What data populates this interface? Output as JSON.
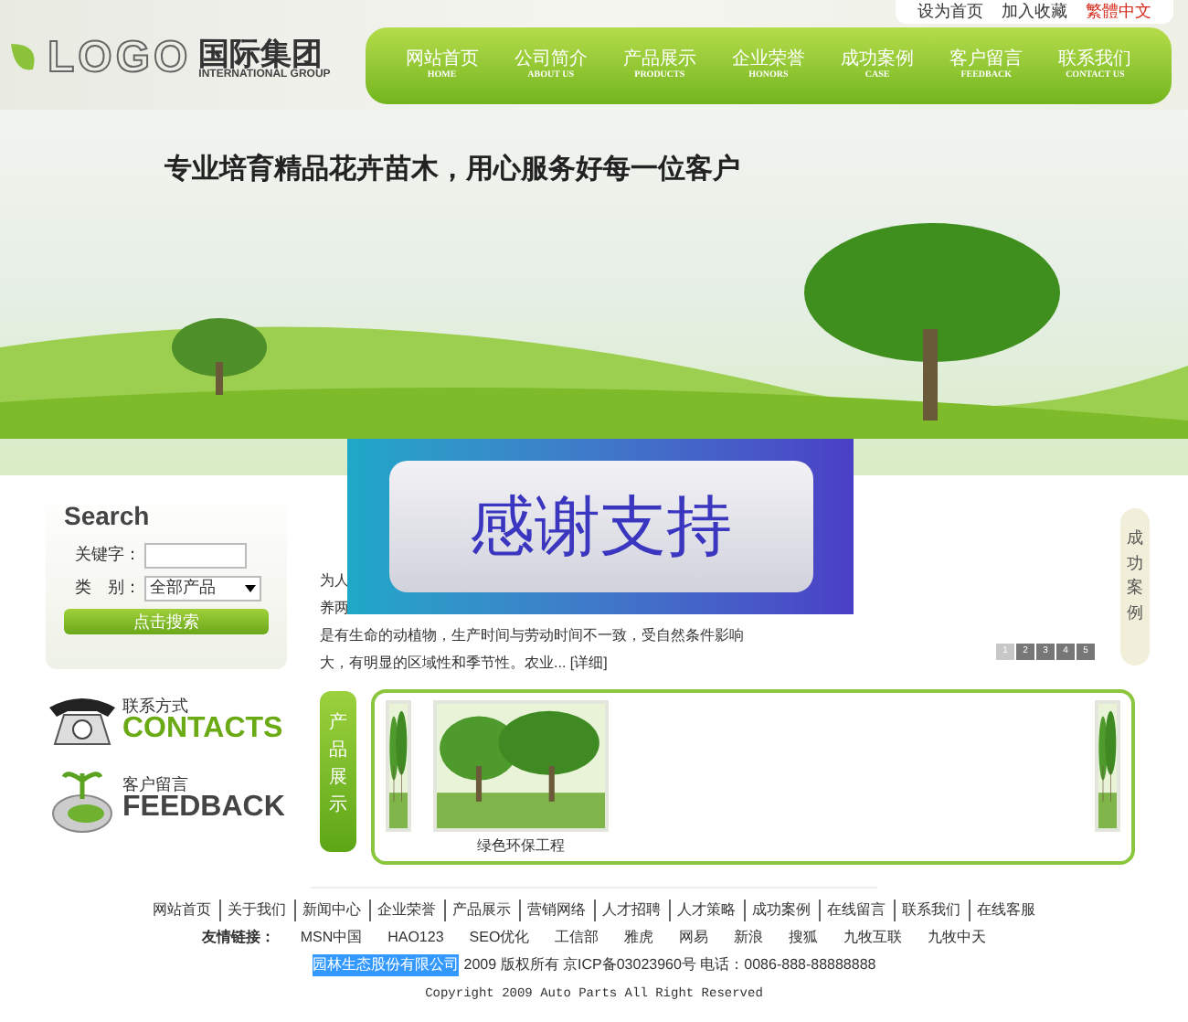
{
  "header": {
    "logo": "LOGO",
    "company": "国际集团",
    "company_en": "INTERNATIONAL GROUP"
  },
  "top_links": [
    {
      "label": "设为首页",
      "kind": "normal"
    },
    {
      "label": "加入收藏",
      "kind": "normal"
    },
    {
      "label": "繁體中文",
      "kind": "highlight"
    }
  ],
  "nav": [
    {
      "label": "网站首页",
      "sublabel": "HOME"
    },
    {
      "label": "公司简介",
      "sublabel": "ABOUT US"
    },
    {
      "label": "产品展示",
      "sublabel": "PRODUCTS"
    },
    {
      "label": "企业荣誉",
      "sublabel": "HONORS"
    },
    {
      "label": "成功案例",
      "sublabel": "CASE"
    },
    {
      "label": "客户留言",
      "sublabel": "FEEDBACK"
    },
    {
      "label": "联系我们",
      "sublabel": "CONTACT US"
    }
  ],
  "banner": {
    "slogan": "专业培育精品花卉苗木，用心服务好每一位客户"
  },
  "search": {
    "title": "Search",
    "keyword_label": "关键字：",
    "category_label": "类　别：",
    "category_value": "全部产品",
    "button": "点击搜索"
  },
  "about": {
    "lines": [
      "为人",
      "养两",
      "是有生命的动植物，生产时间与劳动时间不一致，受自然条件影响",
      "大，有明显的区域性和季节性。农业... [详细]"
    ]
  },
  "overlay": {
    "text": "感谢支持"
  },
  "side_tab": {
    "label": "成功案例"
  },
  "pagination": [
    {
      "label": "1",
      "selected": true
    },
    {
      "label": "2",
      "selected": false
    },
    {
      "label": "3",
      "selected": false
    },
    {
      "label": "4",
      "selected": false
    },
    {
      "label": "5",
      "selected": false
    }
  ],
  "contacts": [
    {
      "kind": "phone",
      "title": "联系方式",
      "label": "CONTACTS"
    },
    {
      "kind": "feedback",
      "title": "客户留言",
      "label": "FEEDBACK"
    }
  ],
  "products": {
    "title": "产品展示",
    "items": [
      {
        "kind": "partial"
      },
      {
        "kind": "full",
        "caption": "绿色环保工程"
      },
      {
        "kind": "spacer"
      },
      {
        "kind": "partial"
      }
    ]
  },
  "footer": {
    "links": [
      "网站首页",
      "关于我们",
      "新闻中心",
      "企业荣誉",
      "产品展示",
      "营销网络",
      "人才招聘",
      "人才策略",
      "成功案例",
      "在线留言",
      "联系我们",
      "在线客服"
    ],
    "friend_label": "友情链接：",
    "friend_links": [
      "MSN中国",
      "HAO123",
      "SEO优化",
      "工信部",
      "雅虎",
      "网易",
      "新浪",
      "搜狐",
      "九牧互联",
      "九牧中天"
    ],
    "company": {
      "text": "园林生态股份有限公司",
      "selected": true
    },
    "info": "2009 版权所有 京ICP备03023960号 电话：0086-888-88888888",
    "copyright": "Copyright 2009 Auto Parts All Right Reserved"
  }
}
